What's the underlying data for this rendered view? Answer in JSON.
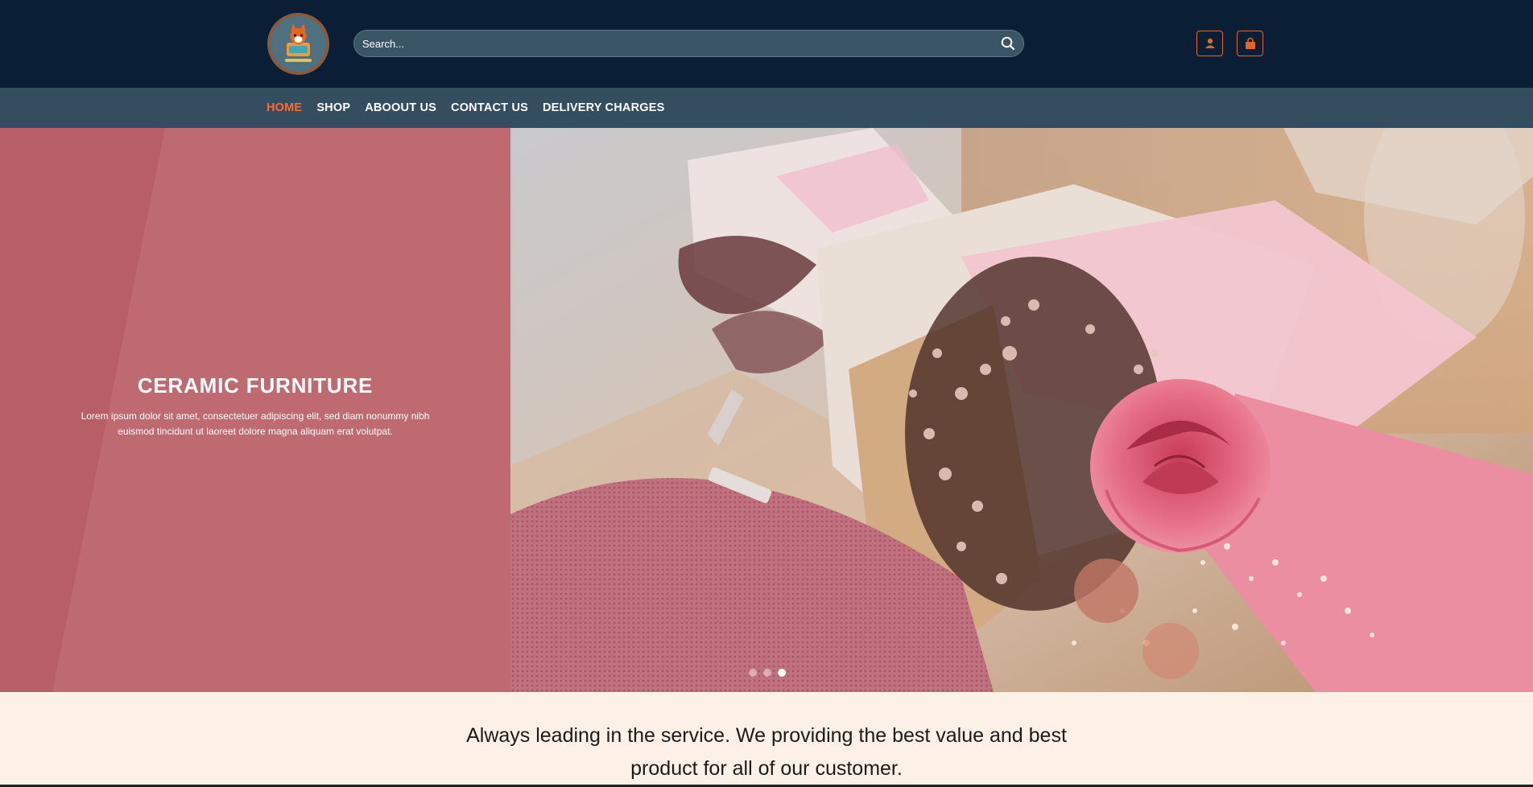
{
  "header": {
    "search_placeholder": "Search..."
  },
  "nav": {
    "items": [
      "HOME",
      "SHOP",
      "ABOOUT US",
      "CONTACT US",
      "DELIVERY CHARGES"
    ],
    "active_index": 0
  },
  "hero": {
    "title": "CERAMIC FURNITURE",
    "text": "Lorem ipsum dolor sit amet, consectetuer adipiscing elit, sed diam nonummy nibh euismod tincidunt ut laoreet dolore magna aliquam erat volutpat.",
    "slide_count": 3,
    "active_slide": 2
  },
  "tagline": {
    "text": "Always leading in the service. We providing the best value and best product for all of our customer."
  },
  "colors": {
    "header_bg": "#0a1f35",
    "nav_bg": "#344d5f",
    "accent": "#ff6a2e",
    "hero_panel": "#bf6a70",
    "section_bg": "#fdf0e6"
  },
  "icons": {
    "search": "search-icon",
    "account": "user-icon",
    "cart": "shopping-bag-icon"
  }
}
